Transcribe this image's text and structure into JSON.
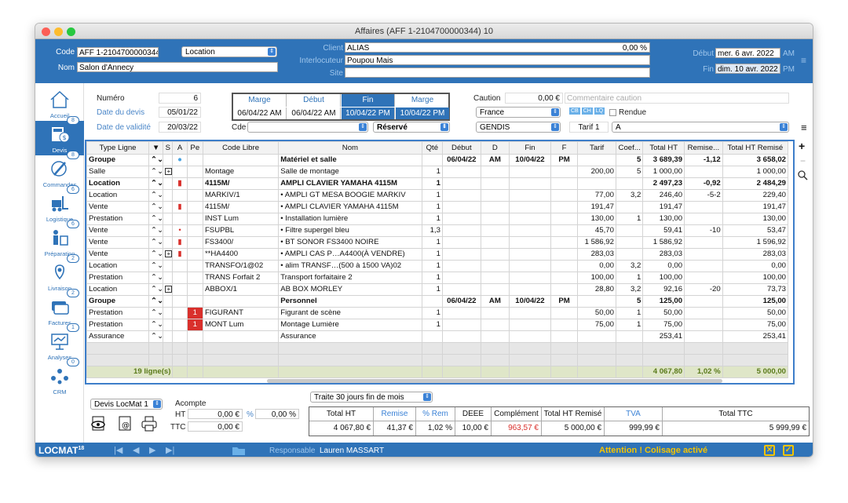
{
  "window": {
    "title": "Affaires (AFF 1-2104700000344) 10"
  },
  "header": {
    "code_label": "Code",
    "code": "AFF 1-2104700000344",
    "type": "Location",
    "nom_label": "Nom",
    "nom": "Salon d'Annecy",
    "client_label": "Client",
    "client": "ALIAS",
    "client_pct": "0,00 %",
    "interlocuteur_label": "Interlocuteur",
    "interlocuteur": "Poupou Mais",
    "site_label": "Site",
    "site": "",
    "debut_label": "Début",
    "debut": "mer. 6 avr. 2022",
    "debut_ampm": "AM",
    "fin_label": "Fin",
    "fin": "dim. 10 avr. 2022",
    "fin_ampm": "PM"
  },
  "sidebar": {
    "items": [
      {
        "label": "Accueil",
        "badge": ""
      },
      {
        "label": "Devis",
        "badge": "8"
      },
      {
        "label": "Commandes",
        "badge": "8"
      },
      {
        "label": "Logistique",
        "badge": "6"
      },
      {
        "label": "Préparation",
        "badge": "6"
      },
      {
        "label": "Livraison",
        "badge": "2"
      },
      {
        "label": "Factures",
        "badge": "2"
      },
      {
        "label": "Analyses",
        "badge": "1"
      },
      {
        "label": "CRM",
        "badge": "0"
      }
    ]
  },
  "info": {
    "numero_label": "Numéro",
    "numero": "6",
    "date_devis_label": "Date du devis",
    "date_devis": "05/01/22",
    "date_validite_label": "Date de validité",
    "date_validite": "20/03/22",
    "cde_label": "Cde",
    "cde": "",
    "statut": "Réservé",
    "caution_label": "Caution",
    "caution": "0,00 €",
    "commentaire_placeholder": "Commentaire caution",
    "pays": "France",
    "rendue_label": "Rendue",
    "tag1": "CB",
    "tag2": "CH",
    "tag3": "LQ",
    "societe": "GENDIS",
    "tarif": "Tarif 1",
    "tarif_code": "A"
  },
  "dates": {
    "headers": [
      "Marge",
      "Début",
      "Fin",
      "Marge"
    ],
    "values": [
      "06/04/22 AM",
      "06/04/22 AM",
      "10/04/22 PM",
      "10/04/22 PM"
    ]
  },
  "grid": {
    "columns": [
      "Type Ligne",
      "",
      "S",
      "A",
      "Pe",
      "Code Libre",
      "Nom",
      "Qté",
      "Début",
      "D",
      "Fin",
      "F",
      "Tarif",
      "Coef...",
      "Total HT",
      "Remise...",
      "Total HT Remisé"
    ],
    "rows": [
      {
        "type": "Groupe",
        "s": "",
        "a": "dot-blue",
        "pe": "",
        "code": "",
        "nom": "Matériel et salle",
        "qte": "",
        "debut": "06/04/22",
        "d": "AM",
        "fin": "10/04/22",
        "f": "PM",
        "tarif": "",
        "coef": "5",
        "total": "3 689,39",
        "remise": "-1,12",
        "remise_total": "3 658,02",
        "style": "bold"
      },
      {
        "type": "Salle",
        "s": "box",
        "a": "",
        "pe": "",
        "code": "Montage",
        "nom": "Salle de montage",
        "qte": "1",
        "debut": "",
        "d": "",
        "fin": "",
        "f": "",
        "tarif": "200,00",
        "coef": "5",
        "total": "1 000,00",
        "remise": "",
        "remise_total": "1 000,00",
        "style": ""
      },
      {
        "type": "Location",
        "s": "",
        "a": "sq-red",
        "pe": "",
        "code": "4115M/",
        "nom": "AMPLI CLAVIER YAMAHA 4115M",
        "qte": "1",
        "debut": "",
        "d": "",
        "fin": "",
        "f": "",
        "tarif": "",
        "coef": "",
        "total": "2 497,23",
        "remise": "-0,92",
        "remise_total": "2 484,29",
        "style": "bold"
      },
      {
        "type": "Location",
        "s": "",
        "a": "",
        "pe": "",
        "code": "MARKIV/1",
        "nom": "• AMPLI GT MESA BOOGIE MARKIV",
        "qte": "1",
        "debut": "",
        "d": "",
        "fin": "",
        "f": "",
        "tarif": "77,00",
        "coef": "3,2",
        "total": "246,40",
        "remise": "-5-2",
        "remise_total": "229,40",
        "style": ""
      },
      {
        "type": "Vente",
        "s": "",
        "a": "sq-red",
        "pe": "",
        "code": "4115M/",
        "nom": "• AMPLI CLAVIER YAMAHA 4115M",
        "qte": "1",
        "debut": "",
        "d": "",
        "fin": "",
        "f": "",
        "tarif": "191,47",
        "coef": "",
        "total": "191,47",
        "remise": "",
        "remise_total": "191,47",
        "style": ""
      },
      {
        "type": "Prestation",
        "s": "",
        "a": "",
        "pe": "",
        "code": "INST Lum",
        "nom": "• Installation lumière",
        "qte": "1",
        "debut": "",
        "d": "",
        "fin": "",
        "f": "",
        "tarif": "130,00",
        "coef": "1",
        "total": "130,00",
        "remise": "",
        "remise_total": "130,00",
        "style": ""
      },
      {
        "type": "Vente",
        "s": "",
        "a": "dot-red",
        "pe": "",
        "code": "FSUPBL",
        "nom": "• Filtre supergel bleu",
        "qte": "1,3",
        "debut": "",
        "d": "",
        "fin": "",
        "f": "",
        "tarif": "45,70",
        "coef": "",
        "total": "59,41",
        "remise": "-10",
        "remise_total": "53,47",
        "style": ""
      },
      {
        "type": "Vente",
        "s": "",
        "a": "sq-red",
        "pe": "",
        "code": "FS3400/",
        "nom": "• BT SONOR FS3400 NOIRE",
        "qte": "1",
        "debut": "",
        "d": "",
        "fin": "",
        "f": "",
        "tarif": "1 586,92",
        "coef": "",
        "total": "1 586,92",
        "remise": "",
        "remise_total": "1 596,92",
        "style": ""
      },
      {
        "type": "Vente",
        "s": "box",
        "a": "sq-red",
        "pe": "",
        "code": "**HA4400",
        "nom": "• AMPLI CAS P…A4400(À VENDRE)",
        "qte": "1",
        "debut": "",
        "d": "",
        "fin": "",
        "f": "",
        "tarif": "283,03",
        "coef": "",
        "total": "283,03",
        "remise": "",
        "remise_total": "283,03",
        "style": ""
      },
      {
        "type": "Location",
        "s": "",
        "a": "",
        "pe": "",
        "code": "TRANSFO/1@02",
        "nom": "• alim TRANSF…(500 à 1500 VA)02",
        "qte": "1",
        "debut": "",
        "d": "",
        "fin": "",
        "f": "",
        "tarif": "0,00",
        "coef": "3,2",
        "total": "0,00",
        "remise": "",
        "remise_total": "0,00",
        "style": ""
      },
      {
        "type": "Prestation",
        "s": "",
        "a": "",
        "pe": "",
        "code": "TRANS Forfait 2",
        "nom": "Transport forfaitaire 2",
        "qte": "1",
        "debut": "",
        "d": "",
        "fin": "",
        "f": "",
        "tarif": "100,00",
        "coef": "1",
        "total": "100,00",
        "remise": "",
        "remise_total": "100,00",
        "style": ""
      },
      {
        "type": "Location",
        "s": "box",
        "a": "",
        "pe": "",
        "code": "ABBOX/1",
        "nom": "AB BOX MORLEY",
        "qte": "1",
        "debut": "",
        "d": "",
        "fin": "",
        "f": "",
        "tarif": "28,80",
        "coef": "3,2",
        "total": "92,16",
        "remise": "-20",
        "remise_total": "73,73",
        "style": ""
      },
      {
        "type": "Groupe",
        "s": "",
        "a": "",
        "pe": "",
        "code": "",
        "nom": "Personnel",
        "qte": "",
        "debut": "06/04/22",
        "d": "AM",
        "fin": "10/04/22",
        "f": "PM",
        "tarif": "",
        "coef": "5",
        "total": "125,00",
        "remise": "",
        "remise_total": "125,00",
        "style": "bold"
      },
      {
        "type": "Prestation",
        "s": "",
        "a": "",
        "pe": "1",
        "code": "FIGURANT",
        "nom": "Figurant de scène",
        "qte": "1",
        "debut": "",
        "d": "",
        "fin": "",
        "f": "",
        "tarif": "50,00",
        "coef": "1",
        "total": "50,00",
        "remise": "",
        "remise_total": "50,00",
        "style": ""
      },
      {
        "type": "Prestation",
        "s": "",
        "a": "",
        "pe": "1",
        "code": "MONT Lum",
        "nom": "Montage Lumière",
        "qte": "1",
        "debut": "",
        "d": "",
        "fin": "",
        "f": "",
        "tarif": "75,00",
        "coef": "1",
        "total": "75,00",
        "remise": "",
        "remise_total": "75,00",
        "style": ""
      },
      {
        "type": "Assurance",
        "s": "",
        "a": "",
        "pe": "",
        "code": "",
        "nom": "Assurance",
        "qte": "",
        "debut": "",
        "d": "",
        "fin": "",
        "f": "",
        "tarif": "",
        "coef": "",
        "total": "253,41",
        "remise": "",
        "remise_total": "253,41",
        "style": ""
      }
    ],
    "footer": {
      "count": "19 ligne(s)",
      "total": "4 067,80",
      "remise": "1,02 %",
      "remise_total": "5 000,00"
    }
  },
  "bottom": {
    "devis_model": "Devis LocMat 1",
    "acompte_label": "Acompte",
    "ht_label": "HT",
    "ht": "0,00 €",
    "pct_symbol": "%",
    "pct": "0,00 %",
    "ttc_label": "TTC",
    "ttc": "0,00 €",
    "payment_terms": "Traite 30 jours fin de mois"
  },
  "totals": {
    "headers": [
      "Total HT",
      "Remise",
      "% Rem",
      "DEEE",
      "Complément",
      "Total HT Remisé",
      "TVA",
      "Total TTC"
    ],
    "values": [
      "4 067,80 €",
      "41,37 €",
      "1,02 %",
      "10,00 €",
      "963,57 €",
      "5 000,00 €",
      "999,99 €",
      "5 999,99 €"
    ]
  },
  "status": {
    "brand": "LOCMAT",
    "version": "18",
    "responsable_label": "Responsable",
    "responsable": "Lauren MASSART",
    "warning": "Attention ! Colisage activé"
  },
  "colors": {
    "primary": "#2f73b8",
    "accent_red": "#d9302c",
    "warning": "#f5c400"
  }
}
